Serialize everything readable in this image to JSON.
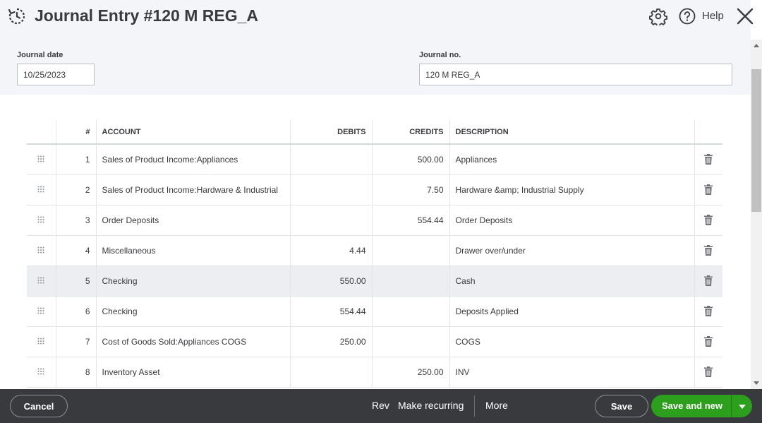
{
  "header": {
    "title": "Journal Entry #120 M REG_A",
    "help_label": "Help"
  },
  "fields": {
    "journal_date_label": "Journal date",
    "journal_date_value": "10/25/2023",
    "journal_no_label": "Journal no.",
    "journal_no_value": "120 M REG_A"
  },
  "table": {
    "columns": {
      "num": "#",
      "account": "ACCOUNT",
      "debits": "DEBITS",
      "credits": "CREDITS",
      "description": "DESCRIPTION"
    },
    "rows": [
      {
        "num": "1",
        "account": "Sales of Product Income:Appliances",
        "debits": "",
        "credits": "500.00",
        "description": "Appliances"
      },
      {
        "num": "2",
        "account": "Sales of Product Income:Hardware & Industrial",
        "debits": "",
        "credits": "7.50",
        "description": "Hardware &amp; Industrial Supply"
      },
      {
        "num": "3",
        "account": "Order Deposits",
        "debits": "",
        "credits": "554.44",
        "description": "Order Deposits"
      },
      {
        "num": "4",
        "account": "Miscellaneous",
        "debits": "4.44",
        "credits": "",
        "description": "Drawer over/under"
      },
      {
        "num": "5",
        "account": "Checking",
        "debits": "550.00",
        "credits": "",
        "description": "Cash"
      },
      {
        "num": "6",
        "account": "Checking",
        "debits": "554.44",
        "credits": "",
        "description": "Deposits Applied"
      },
      {
        "num": "7",
        "account": "Cost of Goods Sold:Appliances COGS",
        "debits": "250.00",
        "credits": "",
        "description": "COGS"
      },
      {
        "num": "8",
        "account": "Inventory Asset",
        "debits": "",
        "credits": "250.00",
        "description": "INV"
      }
    ],
    "highlighted_row": 5
  },
  "footer": {
    "cancel_label": "Cancel",
    "reverse_label": "Rev",
    "make_recurring_label": "Make recurring",
    "more_label": "More",
    "save_label": "Save",
    "save_and_new_label": "Save and new"
  },
  "icons": {
    "history": "history-icon",
    "settings": "gear-icon",
    "help": "help-icon",
    "close": "close-icon",
    "drag": "drag-handle-icon",
    "delete": "trash-icon",
    "dropdown": "caret-down-icon"
  },
  "colors": {
    "primary_green": "#2ca01c",
    "footer_bg": "#393a3d",
    "header_bg": "#f4f5f8",
    "text": "#393a3d"
  }
}
